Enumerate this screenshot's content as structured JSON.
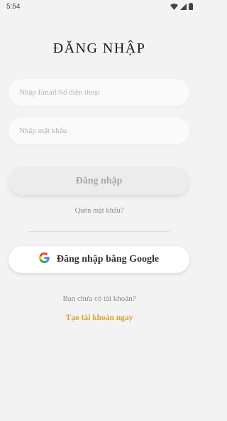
{
  "status_bar": {
    "time": "5:54",
    "icons": [
      "wifi-icon",
      "signal-icon",
      "battery-icon"
    ]
  },
  "login": {
    "title": "ĐĂNG NHẬP",
    "email_placeholder": "Nhập Email/Số điện thoại",
    "email_value": "",
    "password_placeholder": "Nhập mật khẩu",
    "password_value": "",
    "login_button_label": "Đăng nhập",
    "forgot_password_label": "Quên mật khẩu?",
    "google_button_label": "Đăng nhập bằng Google",
    "no_account_text": "Bạn chưa có tài khoản?",
    "create_account_label": "Tạo tài khoản ngay"
  },
  "colors": {
    "background": "#f3f3f3",
    "field_background": "#fafafa",
    "login_button_background": "#ececec",
    "login_button_text": "#a8a8a8",
    "accent_link": "#d6a233",
    "google_blue": "#4285F4",
    "google_red": "#EA4335",
    "google_yellow": "#FBBC05",
    "google_green": "#34A853"
  }
}
